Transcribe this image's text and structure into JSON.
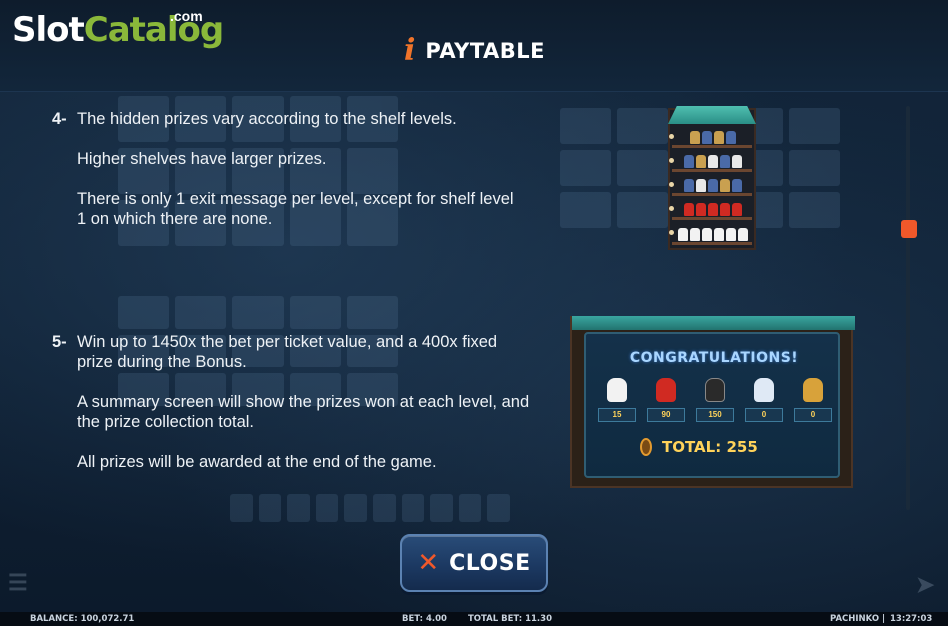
{
  "logo": {
    "slot": "Slot",
    "catalog": "Catalog",
    "com": ".com"
  },
  "header": {
    "icon": "info-icon",
    "title": "PAYTABLE"
  },
  "rules": [
    {
      "number": "4-",
      "paragraphs": [
        "The hidden prizes vary according to the shelf levels.",
        "Higher shelves have larger prizes.",
        "There is only 1 exit message per level, except for shelf level 1 on which there are none."
      ]
    },
    {
      "number": "5-",
      "paragraphs": [
        "Win up to 1450x the bet per ticket value, and a 400x fixed prize during the Bonus.",
        "A summary screen will show the prizes won at each level, and the prize collection total.",
        "All prizes will be awarded at the end of the game."
      ]
    }
  ],
  "congrats_panel": {
    "title": "CONGRATULATIONS!",
    "prizes": [
      "15",
      "90",
      "150",
      "0",
      "0"
    ],
    "total": "TOTAL: 255"
  },
  "close_button": {
    "label": "CLOSE",
    "icon": "close-icon"
  },
  "footer": {
    "balance": "BALANCE: 100,072.71",
    "bet": "BET: 4.00",
    "total_bet": "TOTAL BET: 11.30",
    "game": "PACHINKO |",
    "time": "13:27:03"
  },
  "colors": {
    "accent_orange": "#f0582a",
    "gold": "#ffd35a",
    "logo_green": "#8ab83a",
    "background": "#0d1a2a"
  }
}
